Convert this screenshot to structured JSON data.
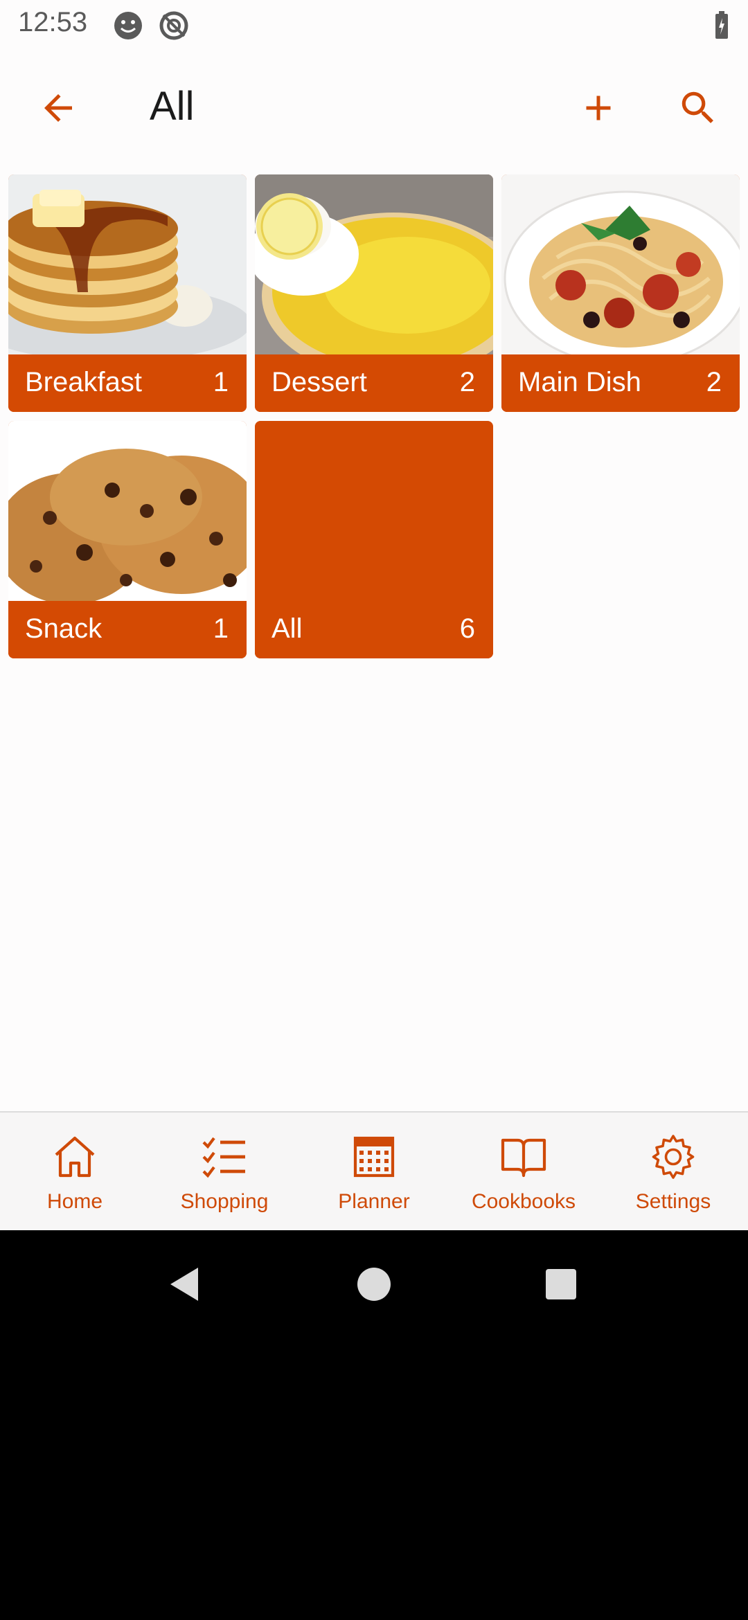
{
  "status_bar": {
    "time": "12:53"
  },
  "toolbar": {
    "title": "All"
  },
  "categories": [
    {
      "name": "Breakfast",
      "count": "1",
      "image": "pancakes"
    },
    {
      "name": "Dessert",
      "count": "2",
      "image": "lemon-tart"
    },
    {
      "name": "Main Dish",
      "count": "2",
      "image": "spaghetti"
    },
    {
      "name": "Snack",
      "count": "1",
      "image": "cookies"
    },
    {
      "name": "All",
      "count": "6",
      "image": "none"
    }
  ],
  "bottom_nav": [
    {
      "label": "Home",
      "icon": "home-icon"
    },
    {
      "label": "Shopping",
      "icon": "checklist-icon"
    },
    {
      "label": "Planner",
      "icon": "calendar-icon"
    },
    {
      "label": "Cookbooks",
      "icon": "book-icon"
    },
    {
      "label": "Settings",
      "icon": "gear-icon"
    }
  ],
  "colors": {
    "accent": "#d44a03",
    "nav_label": "#cf4a08"
  }
}
